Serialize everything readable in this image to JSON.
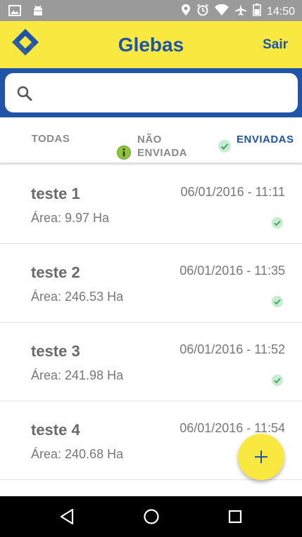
{
  "status_bar": {
    "time": "14:50"
  },
  "app_bar": {
    "title": "Glebas",
    "logout_label": "Sair"
  },
  "search": {
    "value": "",
    "placeholder": ""
  },
  "tabs": [
    {
      "label": "TODAS",
      "selected": false
    },
    {
      "label": "NÃO ENVIADAS",
      "selected": false
    },
    {
      "label": "ENVIADAS",
      "selected": true
    }
  ],
  "items": [
    {
      "name": "teste 1",
      "datetime": "06/01/2016 - 11:11",
      "area": "Área: 9.97 Ha",
      "status": "enviada"
    },
    {
      "name": "teste 2",
      "datetime": "06/01/2016 - 11:35",
      "area": "Área: 246.53 Ha",
      "status": "enviada"
    },
    {
      "name": "teste 3",
      "datetime": "06/01/2016 - 11:52",
      "area": "Área: 241.98 Ha",
      "status": "enviada"
    },
    {
      "name": "teste 4",
      "datetime": "06/01/2016 - 11:54",
      "area": "Área: 240.68 Ha",
      "status": "enviada"
    }
  ],
  "colors": {
    "brand_yellow": "#f8e83f",
    "brand_blue": "#1f54a8",
    "check_green": "#6cc08a",
    "info_green": "#8cc63f"
  },
  "icons": {
    "status": [
      "image-icon",
      "android-icon",
      "location-icon",
      "alarm-icon",
      "wifi-icon",
      "airplane-icon",
      "battery-icon"
    ],
    "fab": "plus-icon",
    "nav": [
      "back-icon",
      "home-icon",
      "recents-icon"
    ]
  }
}
